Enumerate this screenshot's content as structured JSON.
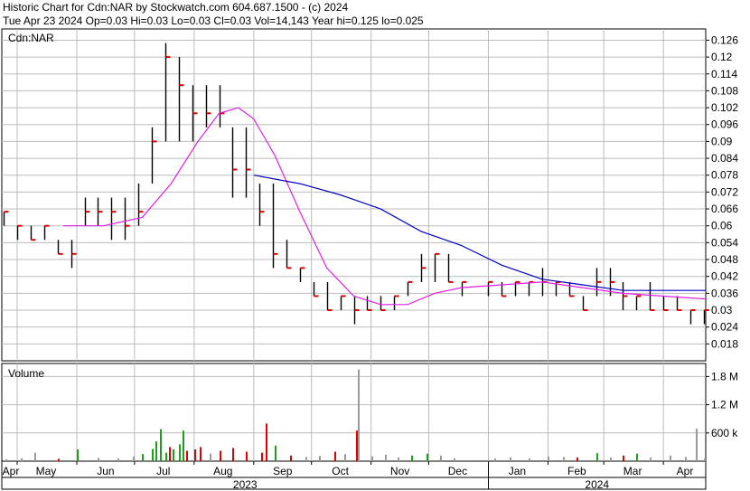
{
  "header": {
    "title": "Historic Chart for Cdn:NAR by Stockwatch.com 604.687.1500 - (c) 2024",
    "quote": "Tue Apr 23 2024  Op=0.03  Hi=0.03  Lo=0.03  Cl=0.03  Vol=14,143  Year hi=0.125  lo=0.025"
  },
  "colors": {
    "price_bar": "#000000",
    "tick": "#e00000",
    "ma_short": "#e020e0",
    "ma_long": "#0000c0",
    "vol_up": "#1aa01a",
    "vol_down": "#e00000",
    "vol_flat": "#9a9a9a",
    "grid": "#bbbbbb"
  },
  "chart_data": [
    {
      "type": "line",
      "title": "Cdn:NAR",
      "x_axis": {
        "months": [
          "Apr",
          "May",
          "Jun",
          "Jul",
          "Aug",
          "Sep",
          "Oct",
          "Nov",
          "Dec",
          "Jan",
          "Feb",
          "Mar",
          "Apr"
        ],
        "years": [
          "2023",
          "2024"
        ],
        "range": [
          "2023-04-23",
          "2024-04-23"
        ]
      },
      "y_axis": {
        "ticks": [
          "0.126",
          "0.12",
          "0.114",
          "0.108",
          "0.102",
          "0.096",
          "0.09",
          "0.084",
          "0.078",
          "0.072",
          "0.066",
          "0.06",
          "0.054",
          "0.048",
          "0.042",
          "0.036",
          "0.03",
          "0.024",
          "0.018"
        ],
        "range": [
          0.012,
          0.13
        ]
      },
      "series": [
        {
          "style": "ohlc",
          "points": [
            {
              "d": "2023-04-24",
              "h": 0.065,
              "l": 0.06,
              "c": 0.065
            },
            {
              "d": "2023-05-01",
              "h": 0.06,
              "l": 0.055,
              "c": 0.06
            },
            {
              "d": "2023-05-08",
              "h": 0.06,
              "l": 0.055,
              "c": 0.055
            },
            {
              "d": "2023-05-15",
              "h": 0.06,
              "l": 0.055,
              "c": 0.06
            },
            {
              "d": "2023-05-22",
              "h": 0.055,
              "l": 0.05,
              "c": 0.05
            },
            {
              "d": "2023-05-29",
              "h": 0.055,
              "l": 0.045,
              "c": 0.05
            },
            {
              "d": "2023-06-05",
              "h": 0.07,
              "l": 0.06,
              "c": 0.065
            },
            {
              "d": "2023-06-12",
              "h": 0.07,
              "l": 0.06,
              "c": 0.065
            },
            {
              "d": "2023-06-19",
              "h": 0.07,
              "l": 0.055,
              "c": 0.065
            },
            {
              "d": "2023-06-26",
              "h": 0.07,
              "l": 0.055,
              "c": 0.06
            },
            {
              "d": "2023-07-03",
              "h": 0.075,
              "l": 0.06,
              "c": 0.065
            },
            {
              "d": "2023-07-10",
              "h": 0.095,
              "l": 0.075,
              "c": 0.09
            },
            {
              "d": "2023-07-17",
              "h": 0.125,
              "l": 0.09,
              "c": 0.12
            },
            {
              "d": "2023-07-24",
              "h": 0.12,
              "l": 0.09,
              "c": 0.11
            },
            {
              "d": "2023-07-31",
              "h": 0.11,
              "l": 0.09,
              "c": 0.1
            },
            {
              "d": "2023-08-07",
              "h": 0.11,
              "l": 0.095,
              "c": 0.1
            },
            {
              "d": "2023-08-14",
              "h": 0.11,
              "l": 0.095,
              "c": 0.1
            },
            {
              "d": "2023-08-21",
              "h": 0.095,
              "l": 0.07,
              "c": 0.08
            },
            {
              "d": "2023-08-28",
              "h": 0.095,
              "l": 0.07,
              "c": 0.08
            },
            {
              "d": "2023-09-04",
              "h": 0.075,
              "l": 0.06,
              "c": 0.065
            },
            {
              "d": "2023-09-11",
              "h": 0.075,
              "l": 0.045,
              "c": 0.05
            },
            {
              "d": "2023-09-18",
              "h": 0.055,
              "l": 0.045,
              "c": 0.045
            },
            {
              "d": "2023-09-25",
              "h": 0.045,
              "l": 0.04,
              "c": 0.045
            },
            {
              "d": "2023-10-02",
              "h": 0.04,
              "l": 0.035,
              "c": 0.035
            },
            {
              "d": "2023-10-09",
              "h": 0.04,
              "l": 0.03,
              "c": 0.03
            },
            {
              "d": "2023-10-16",
              "h": 0.035,
              "l": 0.03,
              "c": 0.035
            },
            {
              "d": "2023-10-23",
              "h": 0.035,
              "l": 0.025,
              "c": 0.03
            },
            {
              "d": "2023-10-30",
              "h": 0.035,
              "l": 0.03,
              "c": 0.03
            },
            {
              "d": "2023-11-06",
              "h": 0.035,
              "l": 0.03,
              "c": 0.03
            },
            {
              "d": "2023-11-13",
              "h": 0.035,
              "l": 0.03,
              "c": 0.035
            },
            {
              "d": "2023-11-20",
              "h": 0.04,
              "l": 0.035,
              "c": 0.04
            },
            {
              "d": "2023-11-27",
              "h": 0.05,
              "l": 0.04,
              "c": 0.045
            },
            {
              "d": "2023-12-04",
              "h": 0.05,
              "l": 0.04,
              "c": 0.05
            },
            {
              "d": "2023-12-11",
              "h": 0.05,
              "l": 0.04,
              "c": 0.04
            },
            {
              "d": "2023-12-18",
              "h": 0.04,
              "l": 0.035,
              "c": 0.04
            },
            {
              "d": "2024-01-01",
              "h": 0.04,
              "l": 0.035,
              "c": 0.04
            },
            {
              "d": "2024-01-08",
              "h": 0.04,
              "l": 0.035,
              "c": 0.035
            },
            {
              "d": "2024-01-15",
              "h": 0.04,
              "l": 0.035,
              "c": 0.04
            },
            {
              "d": "2024-01-22",
              "h": 0.04,
              "l": 0.035,
              "c": 0.04
            },
            {
              "d": "2024-01-29",
              "h": 0.045,
              "l": 0.035,
              "c": 0.04
            },
            {
              "d": "2024-02-05",
              "h": 0.04,
              "l": 0.035,
              "c": 0.04
            },
            {
              "d": "2024-02-12",
              "h": 0.04,
              "l": 0.035,
              "c": 0.035
            },
            {
              "d": "2024-02-19",
              "h": 0.035,
              "l": 0.03,
              "c": 0.03
            },
            {
              "d": "2024-02-26",
              "h": 0.045,
              "l": 0.035,
              "c": 0.04
            },
            {
              "d": "2024-03-04",
              "h": 0.045,
              "l": 0.035,
              "c": 0.04
            },
            {
              "d": "2024-03-11",
              "h": 0.04,
              "l": 0.03,
              "c": 0.035
            },
            {
              "d": "2024-03-18",
              "h": 0.035,
              "l": 0.03,
              "c": 0.035
            },
            {
              "d": "2024-03-25",
              "h": 0.04,
              "l": 0.03,
              "c": 0.03
            },
            {
              "d": "2024-04-01",
              "h": 0.035,
              "l": 0.03,
              "c": 0.03
            },
            {
              "d": "2024-04-08",
              "h": 0.035,
              "l": 0.03,
              "c": 0.03
            },
            {
              "d": "2024-04-15",
              "h": 0.03,
              "l": 0.025,
              "c": 0.03
            },
            {
              "d": "2024-04-22",
              "h": 0.03,
              "l": 0.025,
              "c": 0.03
            }
          ]
        },
        {
          "style": "moving-average-short",
          "points": [
            {
              "d": "2023-05-25",
              "v": 0.06
            },
            {
              "d": "2023-06-15",
              "v": 0.06
            },
            {
              "d": "2023-07-05",
              "v": 0.063
            },
            {
              "d": "2023-07-20",
              "v": 0.075
            },
            {
              "d": "2023-08-03",
              "v": 0.09
            },
            {
              "d": "2023-08-14",
              "v": 0.1
            },
            {
              "d": "2023-08-24",
              "v": 0.102
            },
            {
              "d": "2023-09-01",
              "v": 0.098
            },
            {
              "d": "2023-09-12",
              "v": 0.085
            },
            {
              "d": "2023-09-25",
              "v": 0.065
            },
            {
              "d": "2023-10-09",
              "v": 0.045
            },
            {
              "d": "2023-10-23",
              "v": 0.035
            },
            {
              "d": "2023-11-06",
              "v": 0.032
            },
            {
              "d": "2023-11-20",
              "v": 0.032
            },
            {
              "d": "2023-12-04",
              "v": 0.036
            },
            {
              "d": "2023-12-18",
              "v": 0.038
            },
            {
              "d": "2024-01-08",
              "v": 0.039
            },
            {
              "d": "2024-01-29",
              "v": 0.04
            },
            {
              "d": "2024-02-19",
              "v": 0.038
            },
            {
              "d": "2024-03-11",
              "v": 0.036
            },
            {
              "d": "2024-04-01",
              "v": 0.035
            },
            {
              "d": "2024-04-23",
              "v": 0.034
            }
          ]
        },
        {
          "style": "moving-average-long",
          "points": [
            {
              "d": "2023-09-01",
              "v": 0.078
            },
            {
              "d": "2023-09-25",
              "v": 0.075
            },
            {
              "d": "2023-10-16",
              "v": 0.071
            },
            {
              "d": "2023-11-06",
              "v": 0.066
            },
            {
              "d": "2023-11-27",
              "v": 0.058
            },
            {
              "d": "2023-12-18",
              "v": 0.053
            },
            {
              "d": "2024-01-08",
              "v": 0.046
            },
            {
              "d": "2024-01-29",
              "v": 0.041
            },
            {
              "d": "2024-02-19",
              "v": 0.039
            },
            {
              "d": "2024-03-11",
              "v": 0.037
            },
            {
              "d": "2024-04-01",
              "v": 0.037
            },
            {
              "d": "2024-04-23",
              "v": 0.037
            }
          ]
        }
      ]
    },
    {
      "type": "bar",
      "title": "Volume",
      "y_axis": {
        "ticks": [
          "1.8 M",
          "1.2 M",
          "600 k"
        ],
        "range": [
          0,
          2000000
        ]
      },
      "series": [
        {
          "style": "volume",
          "points": [
            {
              "d": "2023-04-25",
              "v": 40000,
              "dir": "flat"
            },
            {
              "d": "2023-05-03",
              "v": 60000,
              "dir": "flat"
            },
            {
              "d": "2023-05-10",
              "v": 180000,
              "dir": "flat"
            },
            {
              "d": "2023-05-22",
              "v": 50000,
              "dir": "down"
            },
            {
              "d": "2023-06-01",
              "v": 250000,
              "dir": "up"
            },
            {
              "d": "2023-06-12",
              "v": 70000,
              "dir": "flat"
            },
            {
              "d": "2023-06-22",
              "v": 60000,
              "dir": "flat"
            },
            {
              "d": "2023-06-30",
              "v": 100000,
              "dir": "flat"
            },
            {
              "d": "2023-07-05",
              "v": 150000,
              "dir": "up"
            },
            {
              "d": "2023-07-10",
              "v": 260000,
              "dir": "up"
            },
            {
              "d": "2023-07-12",
              "v": 420000,
              "dir": "up"
            },
            {
              "d": "2023-07-14",
              "v": 680000,
              "dir": "up"
            },
            {
              "d": "2023-07-17",
              "v": 180000,
              "dir": "up"
            },
            {
              "d": "2023-07-19",
              "v": 300000,
              "dir": "down"
            },
            {
              "d": "2023-07-21",
              "v": 250000,
              "dir": "up"
            },
            {
              "d": "2023-07-24",
              "v": 360000,
              "dir": "up"
            },
            {
              "d": "2023-07-26",
              "v": 650000,
              "dir": "up"
            },
            {
              "d": "2023-07-28",
              "v": 220000,
              "dir": "down"
            },
            {
              "d": "2023-08-01",
              "v": 250000,
              "dir": "down"
            },
            {
              "d": "2023-08-04",
              "v": 300000,
              "dir": "down"
            },
            {
              "d": "2023-08-09",
              "v": 160000,
              "dir": "flat"
            },
            {
              "d": "2023-08-14",
              "v": 220000,
              "dir": "down"
            },
            {
              "d": "2023-08-21",
              "v": 280000,
              "dir": "down"
            },
            {
              "d": "2023-08-28",
              "v": 200000,
              "dir": "down"
            },
            {
              "d": "2023-09-05",
              "v": 180000,
              "dir": "down"
            },
            {
              "d": "2023-09-07",
              "v": 800000,
              "dir": "down"
            },
            {
              "d": "2023-09-12",
              "v": 330000,
              "dir": "up"
            },
            {
              "d": "2023-09-20",
              "v": 120000,
              "dir": "down"
            },
            {
              "d": "2023-09-28",
              "v": 90000,
              "dir": "flat"
            },
            {
              "d": "2023-10-05",
              "v": 110000,
              "dir": "flat"
            },
            {
              "d": "2023-10-13",
              "v": 200000,
              "dir": "down"
            },
            {
              "d": "2023-10-18",
              "v": 150000,
              "dir": "flat"
            },
            {
              "d": "2023-10-24",
              "v": 650000,
              "dir": "down"
            },
            {
              "d": "2023-10-25",
              "v": 1950000,
              "dir": "flat"
            },
            {
              "d": "2023-11-01",
              "v": 100000,
              "dir": "flat"
            },
            {
              "d": "2023-11-08",
              "v": 140000,
              "dir": "flat"
            },
            {
              "d": "2023-11-15",
              "v": 80000,
              "dir": "flat"
            },
            {
              "d": "2023-11-22",
              "v": 120000,
              "dir": "up"
            },
            {
              "d": "2023-11-30",
              "v": 160000,
              "dir": "up"
            },
            {
              "d": "2023-12-07",
              "v": 120000,
              "dir": "flat"
            },
            {
              "d": "2023-12-14",
              "v": 60000,
              "dir": "flat"
            },
            {
              "d": "2024-01-04",
              "v": 60000,
              "dir": "flat"
            },
            {
              "d": "2024-01-12",
              "v": 80000,
              "dir": "flat"
            },
            {
              "d": "2024-01-22",
              "v": 60000,
              "dir": "flat"
            },
            {
              "d": "2024-02-01",
              "v": 100000,
              "dir": "flat"
            },
            {
              "d": "2024-02-09",
              "v": 90000,
              "dir": "flat"
            },
            {
              "d": "2024-02-16",
              "v": 80000,
              "dir": "down"
            },
            {
              "d": "2024-02-26",
              "v": 170000,
              "dir": "up"
            },
            {
              "d": "2024-03-04",
              "v": 80000,
              "dir": "flat"
            },
            {
              "d": "2024-03-11",
              "v": 120000,
              "dir": "down"
            },
            {
              "d": "2024-03-18",
              "v": 160000,
              "dir": "up"
            },
            {
              "d": "2024-03-25",
              "v": 80000,
              "dir": "flat"
            },
            {
              "d": "2024-04-04",
              "v": 120000,
              "dir": "flat"
            },
            {
              "d": "2024-04-12",
              "v": 90000,
              "dir": "flat"
            },
            {
              "d": "2024-04-18",
              "v": 690000,
              "dir": "flat"
            },
            {
              "d": "2024-04-22",
              "v": 60000,
              "dir": "flat"
            }
          ]
        }
      ]
    }
  ]
}
